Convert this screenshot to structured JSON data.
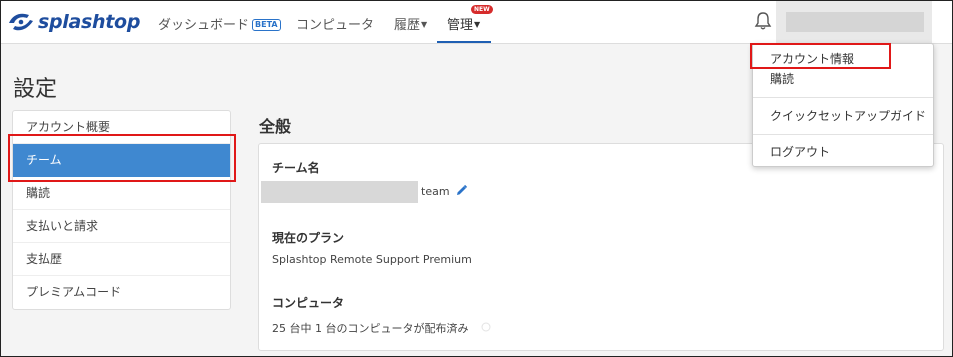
{
  "brand": {
    "name": "splashtop"
  },
  "nav": {
    "dashboard": "ダッシュボード",
    "beta": "BETA",
    "computers": "コンピュータ",
    "history": "履歴",
    "admin": "管理",
    "new_badge": "NEW"
  },
  "page": {
    "title": "設定"
  },
  "sidebar": {
    "items": [
      {
        "label": "アカウント概要"
      },
      {
        "label": "チーム",
        "active": true
      },
      {
        "label": "購読"
      },
      {
        "label": "支払いと請求"
      },
      {
        "label": "支払歴"
      },
      {
        "label": "プレミアムコード"
      }
    ]
  },
  "main": {
    "section_title": "全般",
    "team_name_label": "チーム名",
    "team_suffix": "team",
    "plan_label": "現在のプラン",
    "plan_value": "Splashtop Remote Support Premium",
    "computer_label": "コンピュータ",
    "computer_value": "25 台中 1 台のコンピュータが配布済み"
  },
  "dropdown": {
    "items": [
      {
        "label": "アカウント情報"
      },
      {
        "label": "購読"
      },
      {
        "label": "クイックセットアップガイド"
      },
      {
        "label": "ログアウト"
      }
    ]
  },
  "colors": {
    "brand_blue": "#1e4d9e",
    "active_blue": "#3f88d0",
    "highlight_red": "#e01818",
    "new_red": "#d62c2c"
  }
}
